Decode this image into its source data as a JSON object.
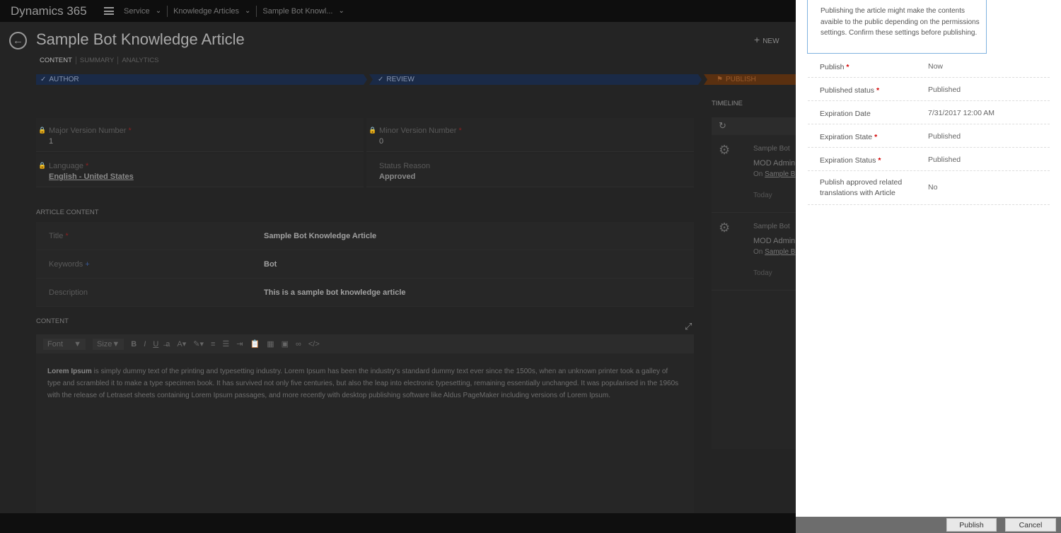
{
  "app": {
    "brand": "Dynamics 365",
    "breadcrumbs": [
      "Service",
      "Knowledge Articles",
      "Sample Bot Knowl..."
    ]
  },
  "record": {
    "title": "Sample Bot Knowledge Article",
    "tabs": [
      "CONTENT",
      "SUMMARY",
      "ANALYTICS"
    ],
    "new_label": "NEW",
    "stages": [
      "AUTHOR",
      "REVIEW",
      "PUBLISH"
    ],
    "fields": {
      "major_version": {
        "label": "Major Version Number",
        "value": "1"
      },
      "minor_version": {
        "label": "Minor Version Number",
        "value": "0"
      },
      "language": {
        "label": "Language",
        "value": "English - United States"
      },
      "status_reason": {
        "label": "Status Reason",
        "value": "Approved"
      }
    },
    "article_content_heading": "ARTICLE CONTENT",
    "article_fields": [
      {
        "label": "Title",
        "value": "Sample Bot Knowledge Article",
        "marker": "*"
      },
      {
        "label": "Keywords",
        "value": "Bot",
        "marker": "+"
      },
      {
        "label": "Description",
        "value": "This is a sample bot knowledge article",
        "marker": ""
      }
    ],
    "content_heading": "CONTENT",
    "editor": {
      "font_label": "Font",
      "size_label": "Size",
      "body_bold": "Lorem Ipsum",
      "body_text": " is simply dummy text of the printing and typesetting industry. Lorem Ipsum has been the industry's standard dummy text ever since the 1500s, when an unknown printer took a galley of type and scrambled it to make a type specimen book. It has survived not only five centuries, but also the leap into electronic typesetting, remaining essentially unchanged. It was popularised in the 1960s with the release of Letraset sheets containing Lorem Ipsum passages, and more recently with desktop publishing software like Aldus PageMaker including versions of Lorem Ipsum."
    },
    "timeline": {
      "heading": "TIMELINE",
      "items": [
        {
          "title": "Sample Bot",
          "by": "MOD Admin",
          "on_prefix": "On",
          "on_link": "Sample B",
          "when": "Today"
        },
        {
          "title": "Sample Bot",
          "by": "MOD Admin",
          "on_prefix": "On",
          "on_link": "Sample B",
          "when": "Today"
        }
      ]
    }
  },
  "publish_dialog": {
    "info": "Publishing the article might make the contents avaible to the public depending on the permissions settings. Confirm these settings before publishing.",
    "rows": [
      {
        "label": "Publish",
        "value": "Now",
        "required": true
      },
      {
        "label": "Published status",
        "value": "Published",
        "required": true
      },
      {
        "label": "Expiration Date",
        "value": "7/31/2017 12:00 AM",
        "required": false
      },
      {
        "label": "Expiration State",
        "value": "Published",
        "required": true
      },
      {
        "label": "Expiration Status",
        "value": "Published",
        "required": true
      },
      {
        "label": "Publish approved related translations with Article",
        "value": "No",
        "required": false
      }
    ],
    "publish_button": "Publish",
    "cancel_button": "Cancel"
  }
}
